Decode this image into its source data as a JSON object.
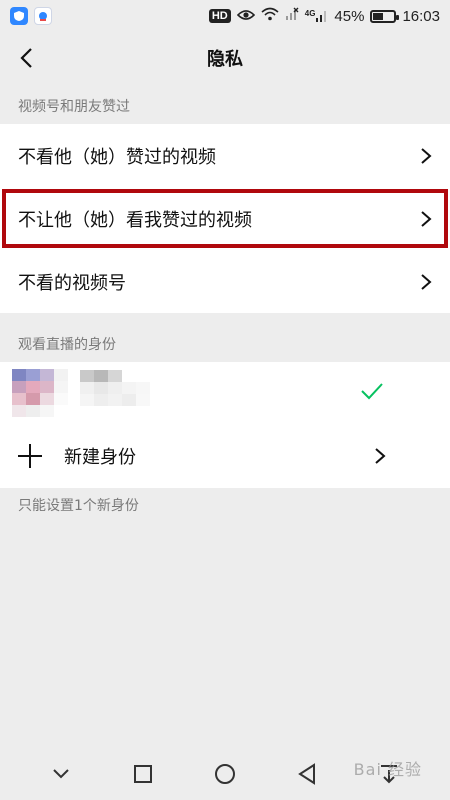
{
  "status_bar": {
    "hd": "HD",
    "network": "4G",
    "battery_percent": "45%",
    "battery_level": 0.45,
    "time": "16:03"
  },
  "nav": {
    "title": "隐私",
    "back_icon": "chevron-left-icon"
  },
  "section1": {
    "header": "视频号和朋友赞过",
    "items": [
      {
        "label": "不看他（她）赞过的视频"
      },
      {
        "label": "不让他（她）看我赞过的视频",
        "highlighted": true
      },
      {
        "label": "不看的视频号"
      }
    ]
  },
  "section2": {
    "header": "观看直播的身份",
    "identity_selected": true,
    "add_identity_label": "新建身份",
    "footnote": "只能设置1个新身份"
  },
  "colors": {
    "highlight_border": "#b0080d",
    "check_green": "#07c160",
    "background": "#ededed"
  },
  "watermark": "Bai 经验"
}
